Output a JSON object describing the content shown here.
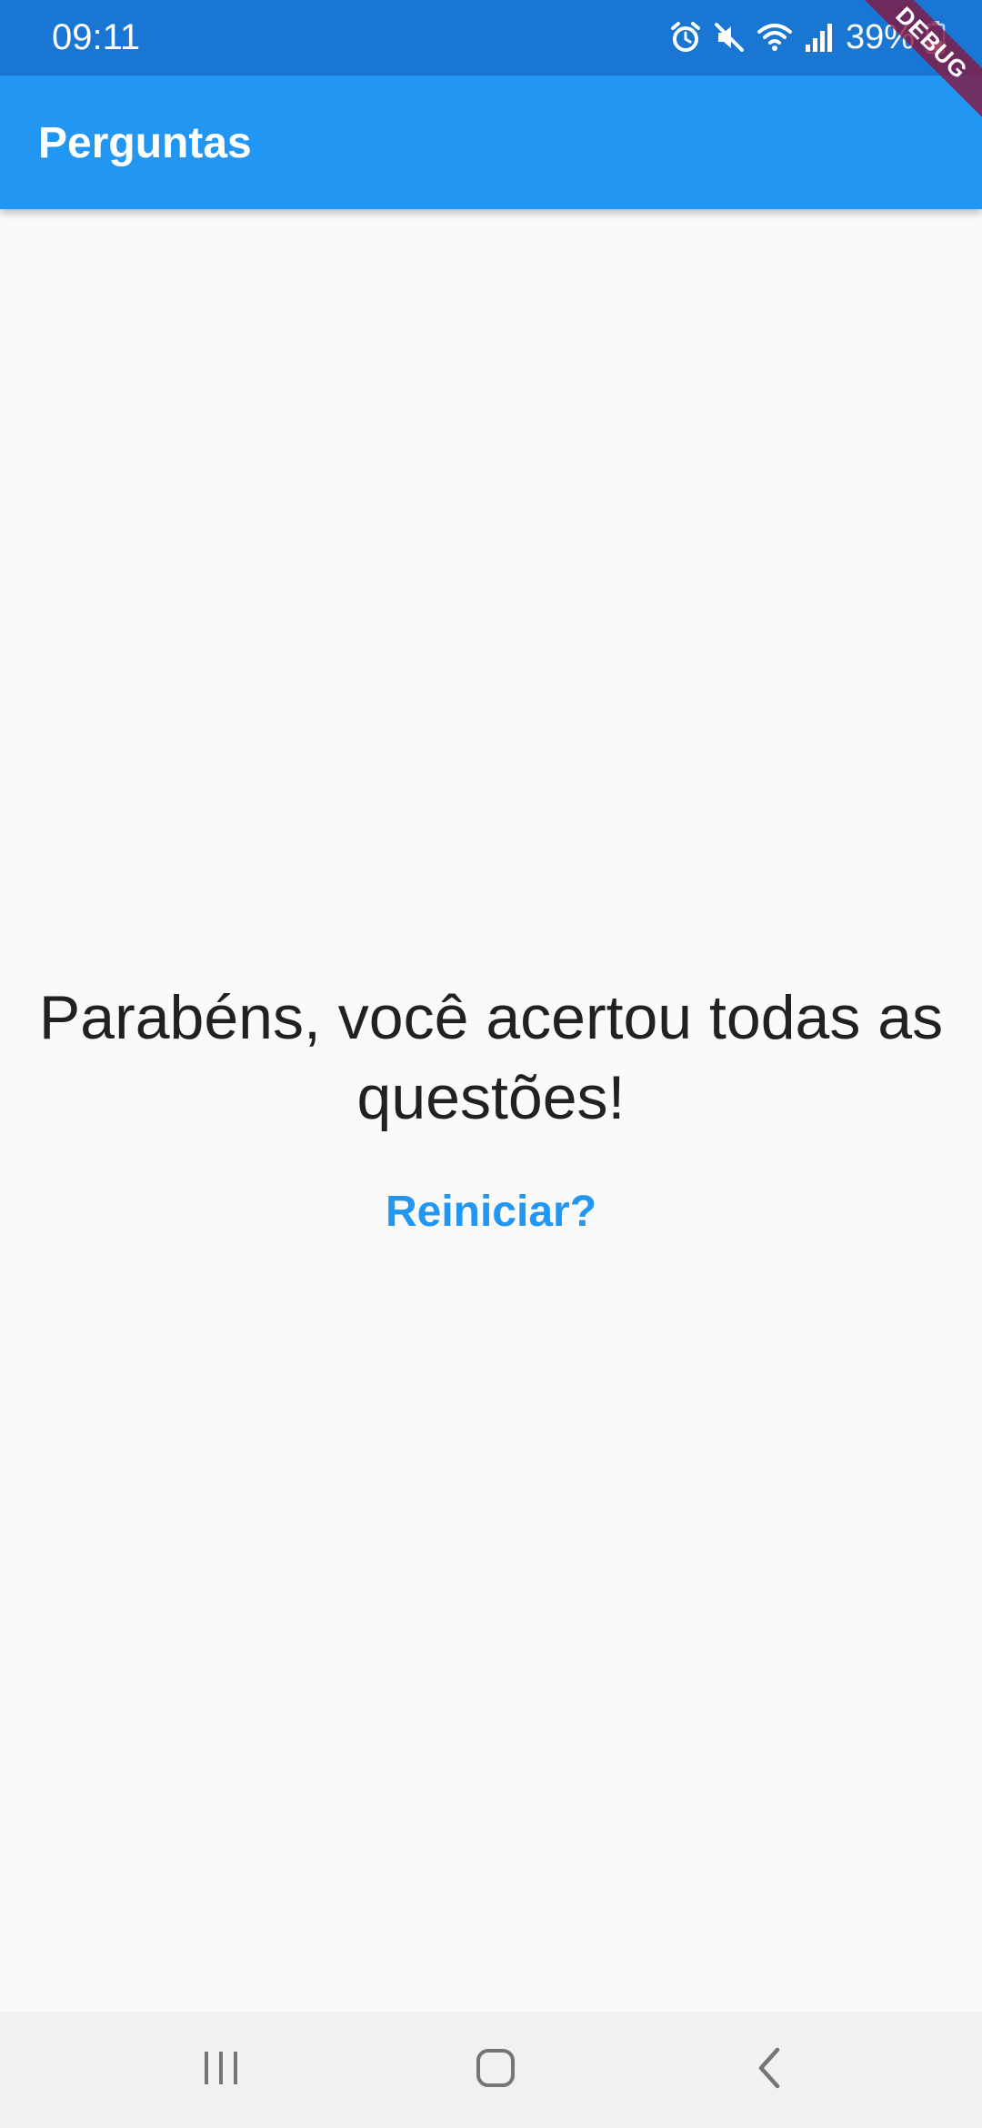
{
  "status_bar": {
    "time": "09:11",
    "battery": "39%",
    "icons": [
      "alarm-icon",
      "mute-icon",
      "wifi-icon",
      "signal-icon",
      "battery-icon"
    ]
  },
  "debug_banner": {
    "label": "DEBUG"
  },
  "app_bar": {
    "title": "Perguntas"
  },
  "result": {
    "message": "Parabéns, você acertou todas as questões!",
    "restart_label": "Reiniciar?"
  },
  "nav_bar": {
    "icons": [
      "recents-icon",
      "home-icon",
      "back-icon"
    ]
  },
  "colors": {
    "primary": "#2196f3",
    "status_bar": "#1976d2",
    "background": "#fafafa",
    "text": "#212121",
    "debug_banner": "#88143c"
  }
}
